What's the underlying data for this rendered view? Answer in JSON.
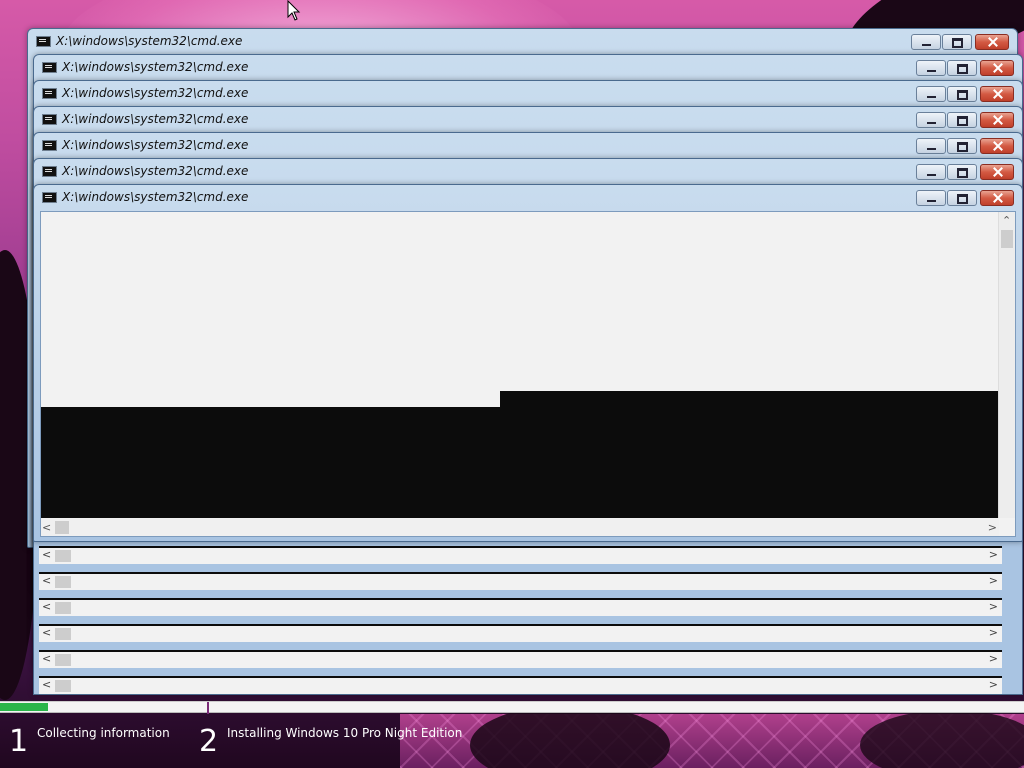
{
  "windows": [
    {
      "title": "X:\\windows\\system32\\cmd.exe"
    },
    {
      "title": "X:\\windows\\system32\\cmd.exe"
    },
    {
      "title": "X:\\windows\\system32\\cmd.exe"
    },
    {
      "title": "X:\\windows\\system32\\cmd.exe"
    },
    {
      "title": "X:\\windows\\system32\\cmd.exe"
    },
    {
      "title": "X:\\windows\\system32\\cmd.exe"
    },
    {
      "title": "X:\\windows\\system32\\cmd.exe"
    }
  ],
  "setup": {
    "progress_fraction": 0.047,
    "steps": [
      {
        "number": "1",
        "label": "Collecting information"
      },
      {
        "number": "2",
        "label": "Installing Windows 10 Pro Night Edition"
      }
    ]
  },
  "icons": {
    "window": "cmd-icon",
    "minimize": "minimize-icon",
    "maximize": "maximize-icon",
    "close": "close-icon",
    "cursor": "mouse-pointer-icon"
  },
  "colors": {
    "progress": "#2bb54a",
    "close_button": "#c0402b",
    "console_bg": "#0c0c0c"
  }
}
